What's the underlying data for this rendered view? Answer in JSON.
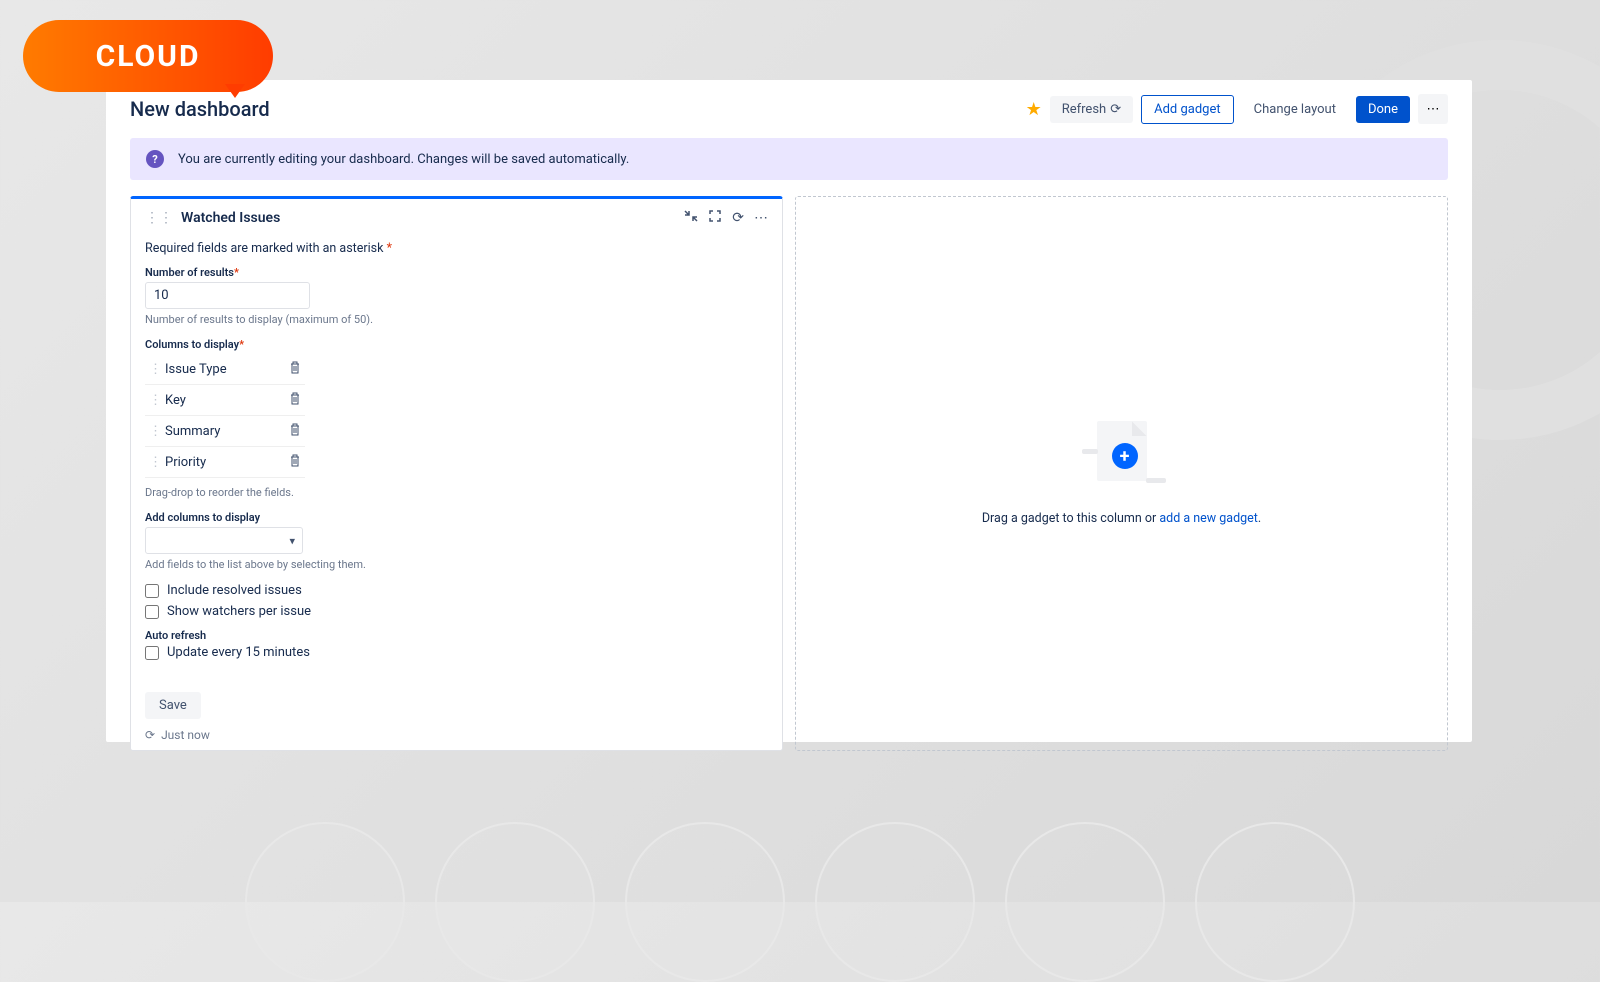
{
  "badge": {
    "label": "CLOUD"
  },
  "header": {
    "title": "New dashboard",
    "buttons": {
      "refresh": "Refresh",
      "add_gadget": "Add gadget",
      "change_layout": "Change layout",
      "done": "Done"
    }
  },
  "banner": {
    "text": "You are currently editing your dashboard. Changes will be saved automatically."
  },
  "gadget": {
    "title": "Watched Issues",
    "required_hint": "Required fields are marked with an asterisk",
    "fields": {
      "number_of_results": {
        "label": "Number of results",
        "value": "10",
        "help": "Number of results to display (maximum of 50)."
      },
      "columns_to_display": {
        "label": "Columns to display",
        "items": [
          "Issue Type",
          "Key",
          "Summary",
          "Priority"
        ],
        "help": "Drag-drop to reorder the fields."
      },
      "add_columns": {
        "label": "Add columns to display",
        "help": "Add fields to the list above by selecting them."
      },
      "include_resolved": "Include resolved issues",
      "show_watchers": "Show watchers per issue",
      "auto_refresh_label": "Auto refresh",
      "update_every": "Update every 15 minutes"
    },
    "save_button": "Save",
    "footer_status": "Just now"
  },
  "dropzone": {
    "prefix": "Drag a gadget to this column or ",
    "link": "add a new gadget",
    "suffix": "."
  }
}
